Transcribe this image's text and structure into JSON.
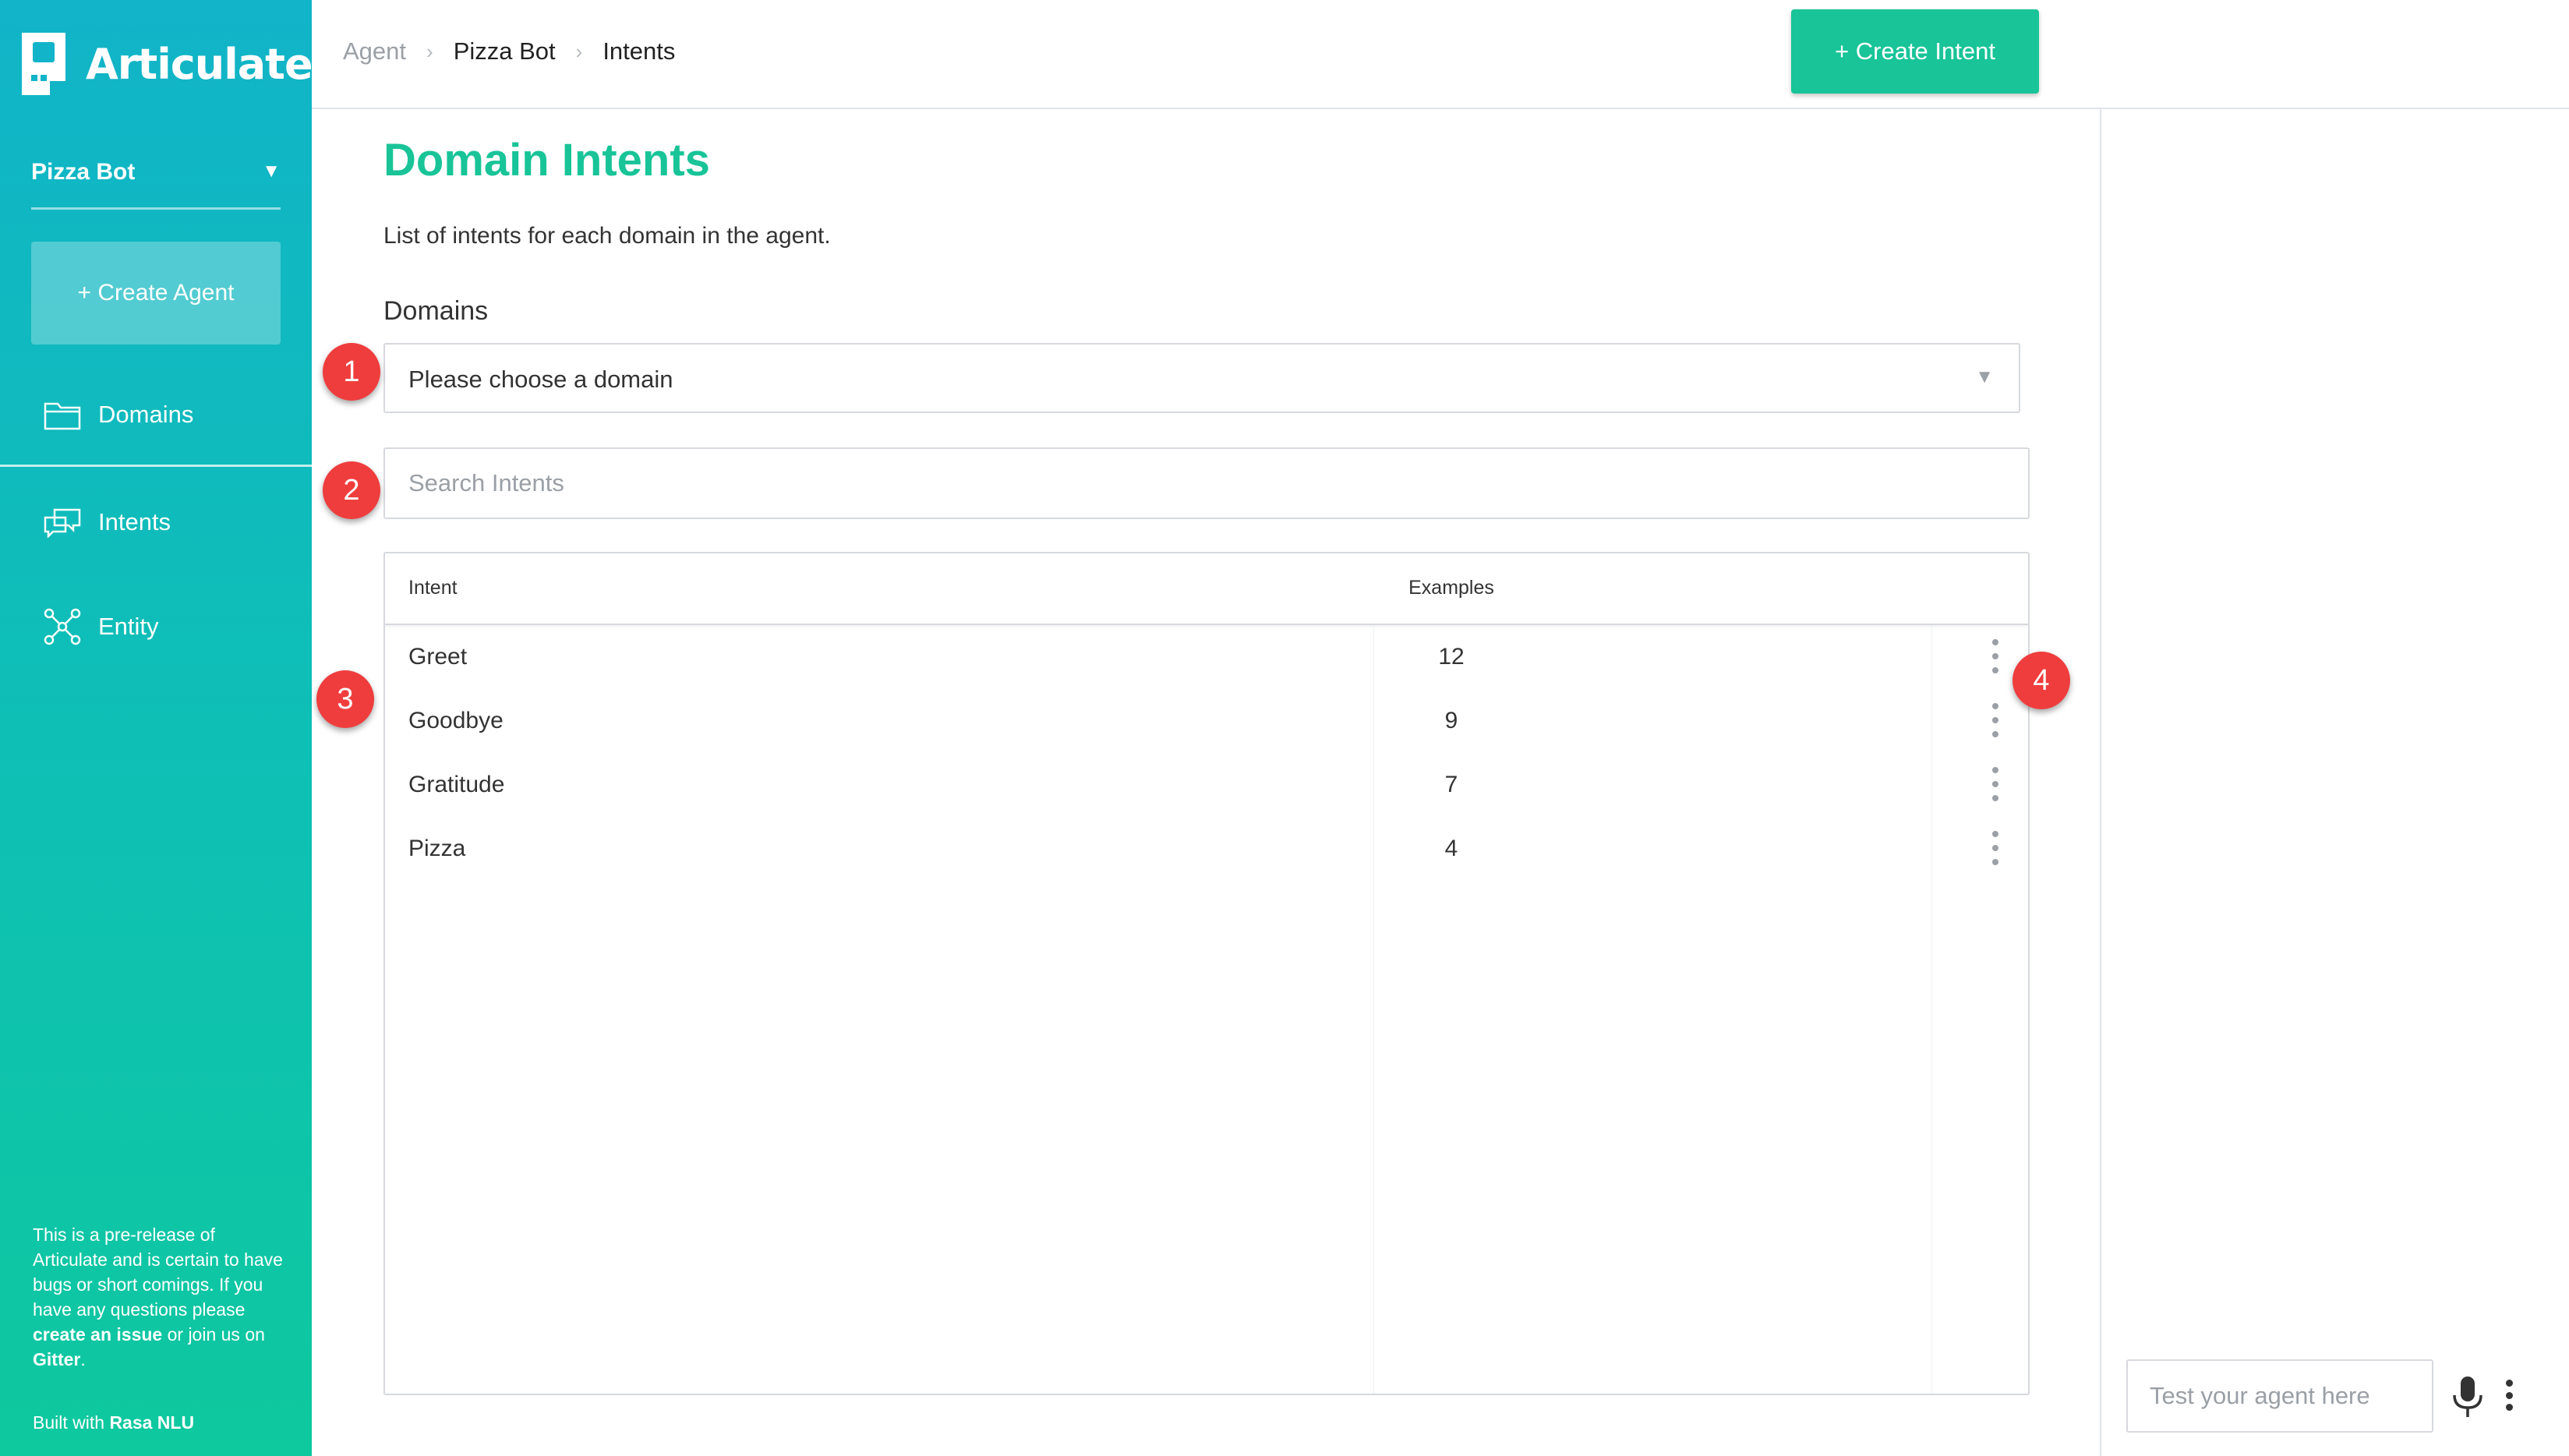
{
  "app": {
    "name": "Articulate"
  },
  "sidebar": {
    "agent_name": "Pizza Bot",
    "agent_arrow": "▼",
    "create_agent_label": "+ Create Agent",
    "nav": [
      {
        "label": "Domains",
        "icon": "folder-icon"
      },
      {
        "label": "Intents",
        "icon": "chat-bubbles-icon"
      },
      {
        "label": "Entity",
        "icon": "network-icon"
      }
    ],
    "footer": {
      "text_1": "This is a pre-release of Articulate and is certain to have bugs or short comings. If you have any questions please ",
      "link_issue": "create an issue",
      "text_2": " or join us on ",
      "link_gitter": "Gitter",
      "text_3": ".",
      "built_with": "Built with ",
      "built_with_link": "Rasa NLU"
    }
  },
  "header": {
    "breadcrumb": [
      "Agent",
      "Pizza Bot",
      "Intents"
    ],
    "breadcrumb_sep": "›",
    "create_intent_label": "+ Create Intent"
  },
  "main": {
    "title": "Domain Intents",
    "subtitle": "List of intents for each domain in the agent.",
    "domains_label": "Domains",
    "domain_placeholder": "Please choose a domain",
    "domain_arrow": "▼",
    "search_placeholder": "Search Intents",
    "table": {
      "headers": {
        "intent": "Intent",
        "examples": "Examples"
      },
      "rows": [
        {
          "intent": "Greet",
          "examples": "12"
        },
        {
          "intent": "Goodbye",
          "examples": "9"
        },
        {
          "intent": "Gratitude",
          "examples": "7"
        },
        {
          "intent": "Pizza",
          "examples": "4"
        }
      ]
    }
  },
  "annotations": [
    "1",
    "2",
    "3",
    "4"
  ],
  "chat": {
    "placeholder": "Test your agent here"
  },
  "colors": {
    "accent": "#18c498",
    "sidebar_top": "#11b4c8",
    "sidebar_bottom": "#0ec89e",
    "badge": "#ef3d3d"
  }
}
